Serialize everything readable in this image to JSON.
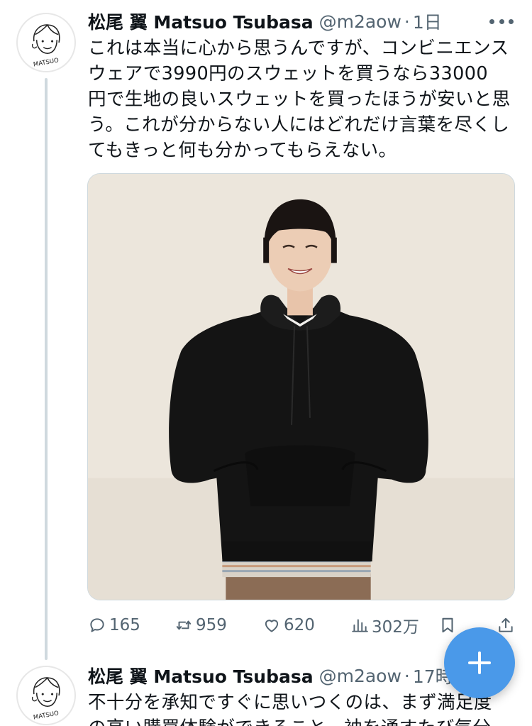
{
  "tweets": [
    {
      "display_name": "松尾 翼 Matsuo Tsubasa",
      "handle": "@m2aow",
      "separator": "·",
      "time": "1日",
      "avatar_text": "MATSUO",
      "text": "これは本当に心から思うんですが、コンビニエンス\nウェアで3990円のスウェットを買うなら33000\n円で生地の良いスウェットを買ったほうが安いと思\nう。これが分からない人にはどれだけ言葉を尽くし\nてもきっと何も分かってもらえない。",
      "media": "photo",
      "counts": {
        "replies": "165",
        "retweets": "959",
        "likes": "620",
        "views": "302万"
      }
    },
    {
      "display_name": "松尾 翼 Matsuo Tsubasa",
      "handle": "@m2aow",
      "separator": "·",
      "time": "17時",
      "avatar_text": "MATSUO",
      "text": "不十分を承知ですぐに思いつくのは、まず満足度\nの高い購買体験ができること、袖を通すたび気分"
    }
  ],
  "icons": {
    "more": "more-icon",
    "reply": "reply-icon",
    "retweet": "retweet-icon",
    "like": "heart-icon",
    "views": "views-icon",
    "bookmark": "bookmark-icon",
    "share": "share-icon",
    "compose": "plus-icon"
  },
  "colors": {
    "accent": "#4a99e9",
    "secondary_text": "#536471",
    "thread_line": "#cfd9de",
    "primary_text": "#0f1419"
  }
}
